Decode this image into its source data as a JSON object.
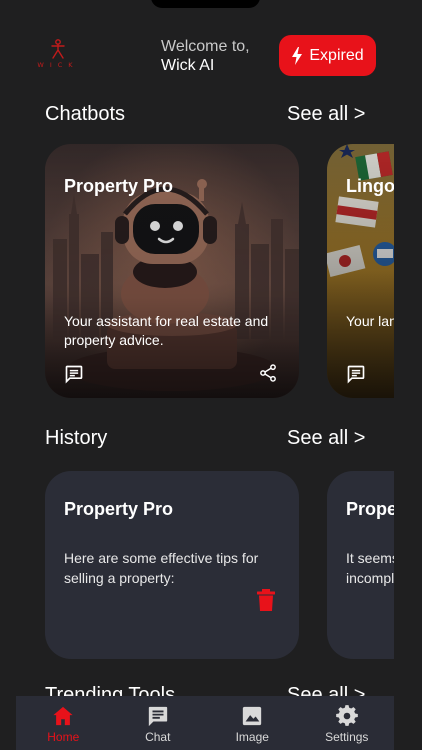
{
  "header": {
    "logo_text": "WICK",
    "welcome_line1": "Welcome to,",
    "welcome_line2": "Wick AI",
    "expired_label": "Expired"
  },
  "chatbots": {
    "title": "Chatbots",
    "see_all": "See all >",
    "cards": [
      {
        "name": "Property Pro",
        "description": "Your assistant for real estate and property advice."
      },
      {
        "name": "Lingo",
        "description": "Your language learning companion."
      }
    ]
  },
  "history": {
    "title": "History",
    "see_all": "See all >",
    "cards": [
      {
        "name": "Property Pro",
        "text": "Here are some effective tips for selling a property:"
      },
      {
        "name": "Property Pro",
        "text": "It seems your question is incomplete."
      }
    ]
  },
  "trending": {
    "title": "Trending Tools",
    "see_all": "See all >"
  },
  "nav": {
    "items": [
      {
        "label": "Home",
        "icon": "home-icon",
        "active": true
      },
      {
        "label": "Chat",
        "icon": "chat-icon",
        "active": false
      },
      {
        "label": "Image",
        "icon": "image-icon",
        "active": false
      },
      {
        "label": "Settings",
        "icon": "settings-icon",
        "active": false
      }
    ]
  },
  "colors": {
    "background": "#1f1f20",
    "accent": "#e8121a",
    "card": "#2b2d37",
    "nav": "#2a2c36"
  }
}
